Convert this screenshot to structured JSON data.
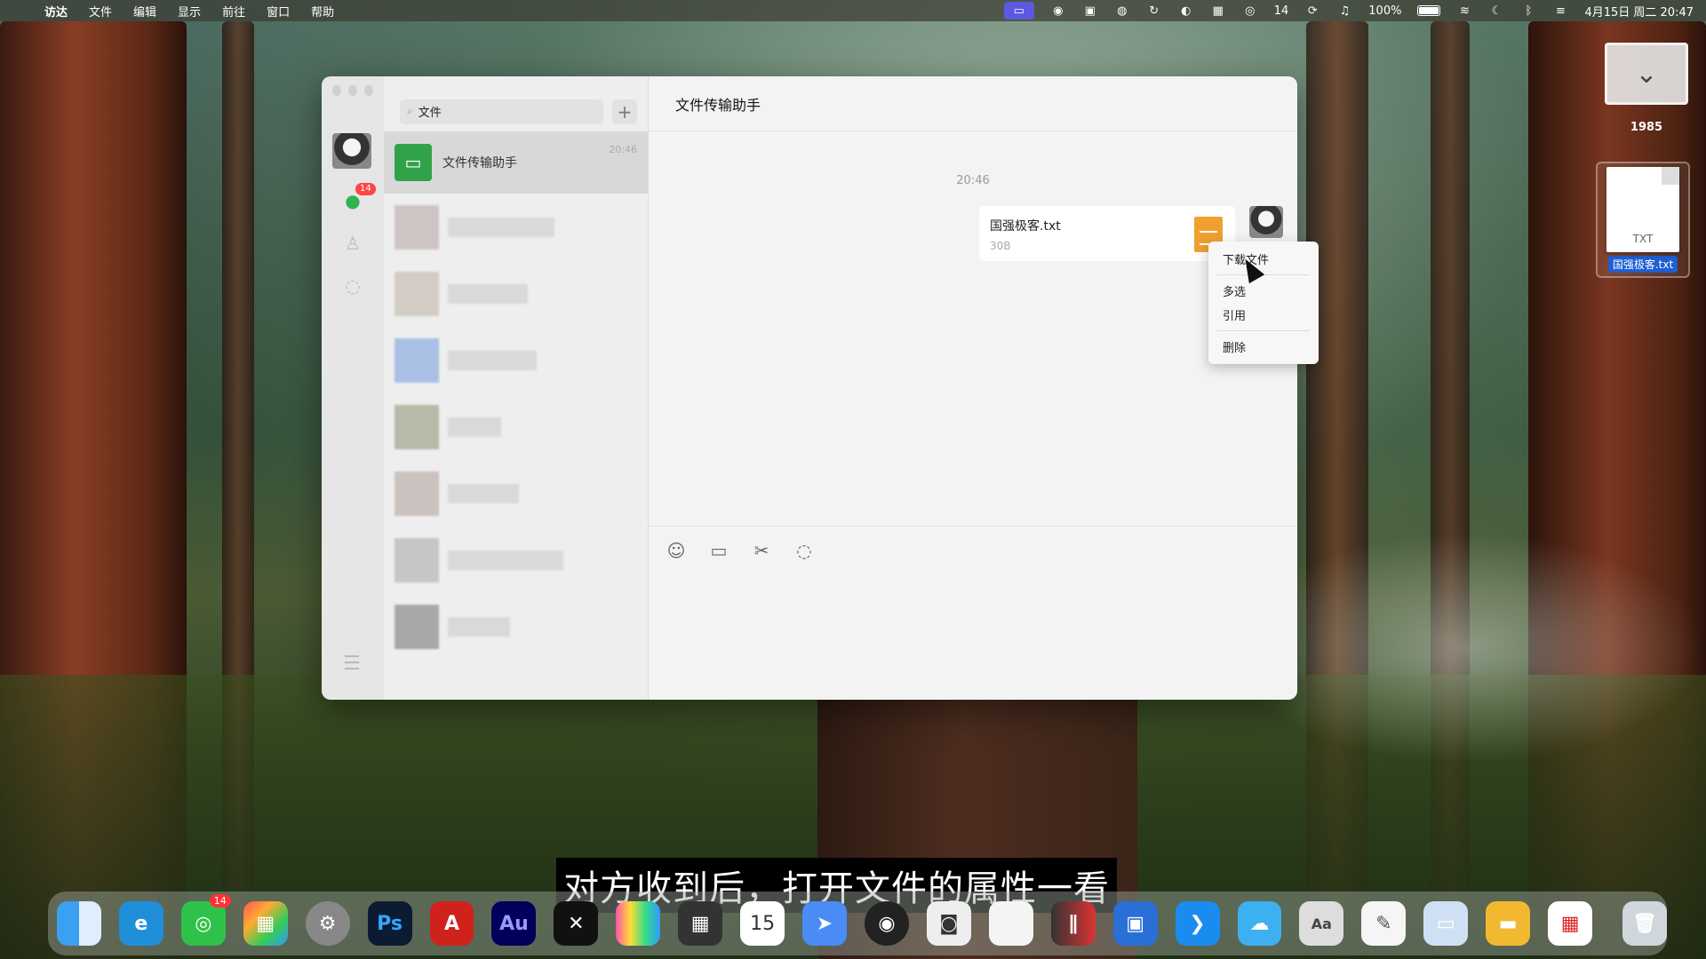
{
  "menubar": {
    "items": [
      "访达",
      "文件",
      "编辑",
      "显示",
      "前往",
      "窗口",
      "帮助"
    ],
    "wechat_badge": "14",
    "battery": "100%",
    "datetime": "4月15日 周二 20:47"
  },
  "desktop": {
    "folder_label": "1985",
    "file_label": "国强极客.txt",
    "file_type": "TXT"
  },
  "wechat": {
    "search_value": "文件",
    "nav_badge": "14",
    "selected_chat": {
      "title": "文件传输助手",
      "time": "20:46"
    },
    "header_title": "文件传输助手",
    "message_time": "20:46",
    "file_message": {
      "name": "国强极客.txt",
      "size": "30B"
    }
  },
  "context_menu": {
    "download": "下载文件",
    "multi_select": "多选",
    "quote": "引用",
    "delete": "删除"
  },
  "subtitle": "对方收到后，打开文件的属性一看",
  "dock": {
    "wechat_badge": "14",
    "calendar_day": "15"
  }
}
